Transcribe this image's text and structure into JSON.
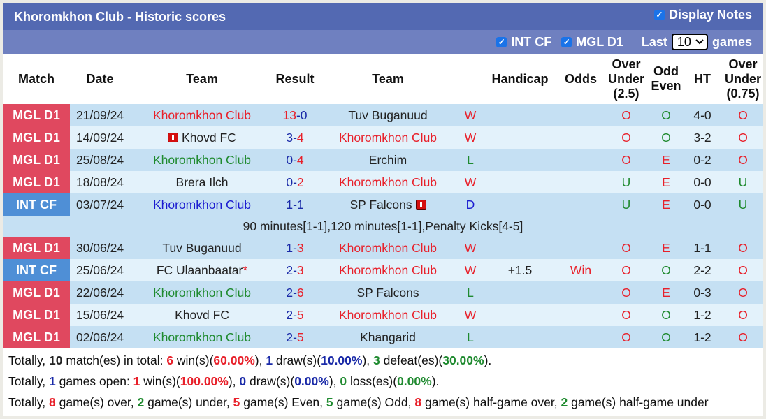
{
  "title": "Khoromkhon Club - Historic scores",
  "display_notes": {
    "label": "Display Notes",
    "checked": true
  },
  "filters": {
    "int_cf": {
      "label": "INT CF",
      "checked": true
    },
    "mgl_d1": {
      "label": "MGL D1",
      "checked": true
    },
    "last_label": "Last",
    "last_value": "10",
    "games_label": "games"
  },
  "headers": {
    "match": "Match",
    "date": "Date",
    "team1": "Team",
    "result": "Result",
    "team2": "Team",
    "handicap": "Handicap",
    "odds": "Odds",
    "ou25": [
      "Over",
      "Under",
      "(2.5)"
    ],
    "oddeven": [
      "Odd",
      "Even"
    ],
    "ht": "HT",
    "ou075": [
      "Over",
      "Under",
      "(0.75)"
    ]
  },
  "colors": {
    "mgl": "#e0485f",
    "int": "#4f8fd6",
    "header": "#5369b2",
    "subheader": "#6f80c0"
  },
  "rows": [
    {
      "comp": "MGL D1",
      "date": "21/09/24",
      "home": "Khoromkhon Club",
      "home_color": "red",
      "home_flag": false,
      "home_star": false,
      "score_home": "13",
      "score_away": "0",
      "sh_color": "red",
      "sa_color": "navy",
      "away": "Tuv Buganuud",
      "away_color": "dark",
      "away_flag": false,
      "wl": "W",
      "handicap": "",
      "odds": "",
      "ou": "O",
      "oe": "O",
      "ht": "4-0",
      "ou2": "O"
    },
    {
      "comp": "MGL D1",
      "date": "14/09/24",
      "home": "Khovd FC",
      "home_color": "dark",
      "home_flag": true,
      "home_star": false,
      "score_home": "3",
      "score_away": "4",
      "sh_color": "navy",
      "sa_color": "red",
      "away": "Khoromkhon Club",
      "away_color": "red",
      "away_flag": false,
      "wl": "W",
      "handicap": "",
      "odds": "",
      "ou": "O",
      "oe": "O",
      "ht": "3-2",
      "ou2": "O"
    },
    {
      "comp": "MGL D1",
      "date": "25/08/24",
      "home": "Khoromkhon Club",
      "home_color": "green",
      "home_flag": false,
      "home_star": false,
      "score_home": "0",
      "score_away": "4",
      "sh_color": "navy",
      "sa_color": "red",
      "away": "Erchim",
      "away_color": "dark",
      "away_flag": false,
      "wl": "L",
      "handicap": "",
      "odds": "",
      "ou": "O",
      "oe": "E",
      "ht": "0-2",
      "ou2": "O"
    },
    {
      "comp": "MGL D1",
      "date": "18/08/24",
      "home": "Brera Ilch",
      "home_color": "dark",
      "home_flag": false,
      "home_star": false,
      "score_home": "0",
      "score_away": "2",
      "sh_color": "navy",
      "sa_color": "red",
      "away": "Khoromkhon Club",
      "away_color": "red",
      "away_flag": false,
      "wl": "W",
      "handicap": "",
      "odds": "",
      "ou": "U",
      "oe": "E",
      "ht": "0-0",
      "ou2": "U"
    },
    {
      "comp": "INT CF",
      "date": "03/07/24",
      "home": "Khoromkhon Club",
      "home_color": "blue",
      "home_flag": false,
      "home_star": false,
      "score_home": "1",
      "score_away": "1",
      "sh_color": "navy",
      "sa_color": "navy",
      "away": "SP Falcons",
      "away_color": "dark",
      "away_flag": true,
      "wl": "D",
      "handicap": "",
      "odds": "",
      "ou": "U",
      "oe": "E",
      "ht": "0-0",
      "ou2": "U",
      "note": "90 minutes[1-1],120 minutes[1-1],Penalty Kicks[4-5]"
    },
    {
      "comp": "MGL D1",
      "date": "30/06/24",
      "home": "Tuv Buganuud",
      "home_color": "dark",
      "home_flag": false,
      "home_star": false,
      "score_home": "1",
      "score_away": "3",
      "sh_color": "navy",
      "sa_color": "red",
      "away": "Khoromkhon Club",
      "away_color": "red",
      "away_flag": false,
      "wl": "W",
      "handicap": "",
      "odds": "",
      "ou": "O",
      "oe": "E",
      "ht": "1-1",
      "ou2": "O"
    },
    {
      "comp": "INT CF",
      "date": "25/06/24",
      "home": "FC Ulaanbaatar",
      "home_color": "dark",
      "home_flag": false,
      "home_star": true,
      "score_home": "2",
      "score_away": "3",
      "sh_color": "navy",
      "sa_color": "red",
      "away": "Khoromkhon Club",
      "away_color": "red",
      "away_flag": false,
      "wl": "W",
      "handicap": "+1.5",
      "odds": "Win",
      "ou": "O",
      "oe": "O",
      "ht": "2-2",
      "ou2": "O"
    },
    {
      "comp": "MGL D1",
      "date": "22/06/24",
      "home": "Khoromkhon Club",
      "home_color": "green",
      "home_flag": false,
      "home_star": false,
      "score_home": "2",
      "score_away": "6",
      "sh_color": "navy",
      "sa_color": "red",
      "away": "SP Falcons",
      "away_color": "dark",
      "away_flag": false,
      "wl": "L",
      "handicap": "",
      "odds": "",
      "ou": "O",
      "oe": "E",
      "ht": "0-3",
      "ou2": "O"
    },
    {
      "comp": "MGL D1",
      "date": "15/06/24",
      "home": "Khovd FC",
      "home_color": "dark",
      "home_flag": false,
      "home_star": false,
      "score_home": "2",
      "score_away": "5",
      "sh_color": "navy",
      "sa_color": "red",
      "away": "Khoromkhon Club",
      "away_color": "red",
      "away_flag": false,
      "wl": "W",
      "handicap": "",
      "odds": "",
      "ou": "O",
      "oe": "O",
      "ht": "1-2",
      "ou2": "O"
    },
    {
      "comp": "MGL D1",
      "date": "02/06/24",
      "home": "Khoromkhon Club",
      "home_color": "green",
      "home_flag": false,
      "home_star": false,
      "score_home": "2",
      "score_away": "5",
      "sh_color": "navy",
      "sa_color": "red",
      "away": "Khangarid",
      "away_color": "dark",
      "away_flag": false,
      "wl": "L",
      "handicap": "",
      "odds": "",
      "ou": "O",
      "oe": "O",
      "ht": "1-2",
      "ou2": "O"
    }
  ],
  "summary": [
    [
      {
        "t": "Totally, "
      },
      {
        "t": "10",
        "c": "dark",
        "b": true
      },
      {
        "t": " match(es) in total: "
      },
      {
        "t": "6",
        "c": "red",
        "b": true
      },
      {
        "t": " win(s)("
      },
      {
        "t": "60.00%",
        "c": "red",
        "b": true
      },
      {
        "t": "), "
      },
      {
        "t": "1",
        "c": "navy",
        "b": true
      },
      {
        "t": " draw(s)("
      },
      {
        "t": "10.00%",
        "c": "navy",
        "b": true
      },
      {
        "t": "), "
      },
      {
        "t": "3",
        "c": "green",
        "b": true
      },
      {
        "t": " defeat(es)("
      },
      {
        "t": "30.00%",
        "c": "green",
        "b": true
      },
      {
        "t": ")."
      }
    ],
    [
      {
        "t": "Totally, "
      },
      {
        "t": "1",
        "c": "navy",
        "b": true
      },
      {
        "t": " games open: "
      },
      {
        "t": "1",
        "c": "red",
        "b": true
      },
      {
        "t": " win(s)("
      },
      {
        "t": "100.00%",
        "c": "red",
        "b": true
      },
      {
        "t": "), "
      },
      {
        "t": "0",
        "c": "navy",
        "b": true
      },
      {
        "t": " draw(s)("
      },
      {
        "t": "0.00%",
        "c": "navy",
        "b": true
      },
      {
        "t": "), "
      },
      {
        "t": "0",
        "c": "green",
        "b": true
      },
      {
        "t": " loss(es)("
      },
      {
        "t": "0.00%",
        "c": "green",
        "b": true
      },
      {
        "t": ")."
      }
    ],
    [
      {
        "t": "Totally, "
      },
      {
        "t": "8",
        "c": "red",
        "b": true
      },
      {
        "t": " game(s) over, "
      },
      {
        "t": "2",
        "c": "green",
        "b": true
      },
      {
        "t": " game(s) under, "
      },
      {
        "t": "5",
        "c": "red",
        "b": true
      },
      {
        "t": " game(s) Even, "
      },
      {
        "t": "5",
        "c": "green",
        "b": true
      },
      {
        "t": " game(s) Odd, "
      },
      {
        "t": "8",
        "c": "red",
        "b": true
      },
      {
        "t": " game(s) half-game over, "
      },
      {
        "t": "2",
        "c": "green",
        "b": true
      },
      {
        "t": " game(s) half-game under"
      }
    ]
  ]
}
